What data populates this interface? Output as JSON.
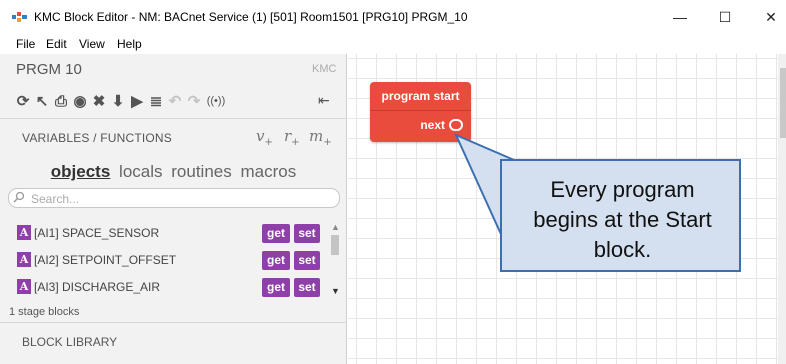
{
  "window": {
    "title": "KMC Block Editor - NM: BACnet Service (1) [501] Room1501 [PRG10] PRGM_10",
    "minimize": "—",
    "maximize": "☐",
    "close": "✕"
  },
  "menu": [
    "File",
    "Edit",
    "View",
    "Help"
  ],
  "sidebar": {
    "program_name": "PRGM  10",
    "brand": "KMC",
    "toolbar_icons": [
      "refresh-icon",
      "cursor-icon",
      "save-icon",
      "stop-icon",
      "close-icon",
      "download-icon",
      "run-icon",
      "format-icon",
      "undo-icon",
      "redo-icon",
      "broadcast-icon"
    ],
    "toolbar_glyphs": [
      "⟳",
      "↖",
      "⎙",
      "◉",
      "✖",
      "⬇",
      "▶",
      "≣",
      "↶",
      "↷",
      "((•))"
    ],
    "collapse_glyph": "⇤",
    "vars_label": "VARIABLES / FUNCTIONS",
    "vrm": [
      {
        "l": "v",
        "s": "+"
      },
      {
        "l": "r",
        "s": "+"
      },
      {
        "l": "m",
        "s": "+"
      }
    ],
    "tabs": [
      "objects",
      "locals",
      "routines",
      "macros"
    ],
    "active_tab": "objects",
    "search_placeholder": "Search...",
    "objects": [
      {
        "badge": "A",
        "name": "[AI1] SPACE_SENSOR",
        "get": "get",
        "set": "set"
      },
      {
        "badge": "A",
        "name": "[AI2] SETPOINT_OFFSET",
        "get": "get",
        "set": "set"
      },
      {
        "badge": "A",
        "name": "[AI3] DISCHARGE_AIR",
        "get": "get",
        "set": "set"
      }
    ],
    "stage_blocks": "1 stage blocks",
    "library_label": "BLOCK LIBRARY"
  },
  "canvas": {
    "start_block": {
      "title": "program start",
      "next": "next"
    },
    "callout": {
      "lines": [
        "Every program",
        "begins at the Start",
        "block."
      ]
    }
  },
  "colors": {
    "start_block": "#e94b3c",
    "accent_purple": "#8e3fa8",
    "callout_fill": "#d4e0ef",
    "callout_border": "#3b6fb0"
  }
}
